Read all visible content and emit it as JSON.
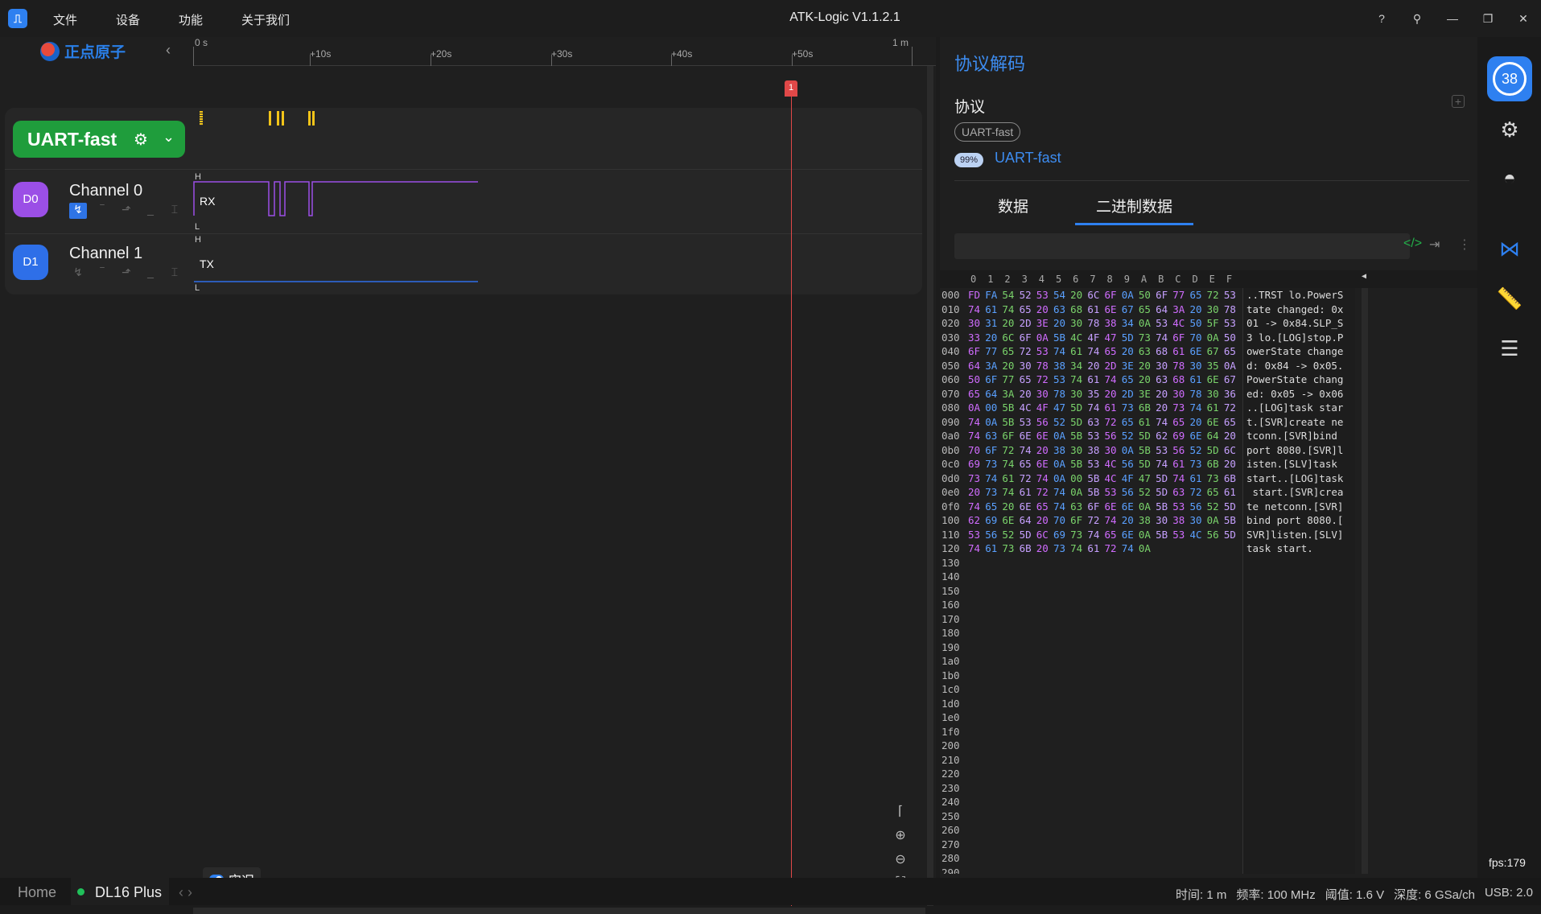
{
  "titlebar": {
    "app_icon": "pulse-icon",
    "menu": [
      "文件",
      "设备",
      "功能",
      "关于我们"
    ],
    "title": "ATK-Logic V1.1.2.1",
    "buttons": [
      "?",
      "pin-icon",
      "minimize-icon",
      "restore-icon",
      "close-icon"
    ]
  },
  "left": {
    "logo_text": "正点原子",
    "ruler_ticks": [
      "0 s",
      "+10s",
      "+20s",
      "+30s",
      "+40s",
      "+50s",
      "1 m"
    ],
    "marker_label": "1",
    "analyzer_label": "UART-fast",
    "channels": [
      {
        "badge": "D0",
        "name": "Channel 0",
        "signal": "RX",
        "color": "#9b4fe6"
      },
      {
        "badge": "D1",
        "name": "Channel 1",
        "signal": "TX",
        "color": "#2e6fe8"
      }
    ],
    "hl": {
      "high": "H",
      "low": "L"
    },
    "live_label": "实况"
  },
  "right": {
    "title": "协议解码",
    "protocol_heading": "协议",
    "protocol_chip": "UART-fast",
    "match_pct": "99%",
    "protocol_name": "UART-fast",
    "tabs": [
      "数据",
      "二进制数据"
    ],
    "active_tab": 1,
    "search_value": "",
    "hex_header": [
      "0",
      "1",
      "2",
      "3",
      "4",
      "5",
      "6",
      "7",
      "8",
      "9",
      "A",
      "B",
      "C",
      "D",
      "E",
      "F"
    ],
    "hex_addresses": [
      "000",
      "010",
      "020",
      "030",
      "040",
      "050",
      "060",
      "070",
      "080",
      "090",
      "0a0",
      "0b0",
      "0c0",
      "0d0",
      "0e0",
      "0f0",
      "100",
      "110",
      "120",
      "130",
      "140",
      "150",
      "160",
      "170",
      "180",
      "190",
      "1a0",
      "1b0",
      "1c0",
      "1d0",
      "1e0",
      "1f0",
      "200",
      "210",
      "220",
      "230",
      "240",
      "250",
      "260",
      "270",
      "280",
      "290"
    ],
    "hex_rows": [
      "FD FA 54 52 53 54 20 6C 6F 0A 50 6F 77 65 72 53",
      "74 61 74 65 20 63 68 61 6E 67 65 64 3A 20 30 78",
      "30 31 20 2D 3E 20 30 78 38 34 0A 53 4C 50 5F 53",
      "33 20 6C 6F 0A 5B 4C 4F 47 5D 73 74 6F 70 0A 50",
      "6F 77 65 72 53 74 61 74 65 20 63 68 61 6E 67 65",
      "64 3A 20 30 78 38 34 20 2D 3E 20 30 78 30 35 0A",
      "50 6F 77 65 72 53 74 61 74 65 20 63 68 61 6E 67",
      "65 64 3A 20 30 78 30 35 20 2D 3E 20 30 78 30 36",
      "0A 00 5B 4C 4F 47 5D 74 61 73 6B 20 73 74 61 72",
      "74 0A 5B 53 56 52 5D 63 72 65 61 74 65 20 6E 65",
      "74 63 6F 6E 6E 0A 5B 53 56 52 5D 62 69 6E 64 20",
      "70 6F 72 74 20 38 30 38 30 0A 5B 53 56 52 5D 6C",
      "69 73 74 65 6E 0A 5B 53 4C 56 5D 74 61 73 6B 20",
      "73 74 61 72 74 0A 00 5B 4C 4F 47 5D 74 61 73 6B",
      "20 73 74 61 72 74 0A 5B 53 56 52 5D 63 72 65 61",
      "74 65 20 6E 65 74 63 6F 6E 6E 0A 5B 53 56 52 5D",
      "62 69 6E 64 20 70 6F 72 74 20 38 30 38 30 0A 5B",
      "53 56 52 5D 6C 69 73 74 65 6E 0A 5B 53 4C 56 5D",
      "74 61 73 6B 20 73 74 61 72 74 0A"
    ],
    "ascii_rows": [
      "..TRST lo.PowerS",
      "tate changed: 0x",
      "01 -> 0x84.SLP_S",
      "3 lo.[LOG]stop.P",
      "owerState change",
      "d: 0x84 -> 0x05.",
      "PowerState chang",
      "ed: 0x05 -> 0x06",
      "..[LOG]task star",
      "t.[SVR]create ne",
      "tconn.[SVR]bind ",
      "port 8080.[SVR]l",
      "isten.[SLV]task ",
      "start..[LOG]task",
      " start.[SVR]crea",
      "te netconn.[SVR]",
      "bind port 8080.[",
      "SVR]listen.[SLV]",
      "task start."
    ]
  },
  "sidebar": {
    "badge": "38",
    "icons": [
      "gear-icon",
      "airplay-icon",
      "waveform-icon",
      "ruler-icon",
      "search-list-icon"
    ],
    "fps": "fps:179"
  },
  "statusbar": {
    "home": "Home",
    "device": "DL16 Plus",
    "nav": "‹ ›",
    "info": [
      "时间: 1 m",
      "频率: 100 MHz",
      "阈值: 1.6 V",
      "深度: 6 GSa/ch",
      "USB: 2.0"
    ]
  }
}
